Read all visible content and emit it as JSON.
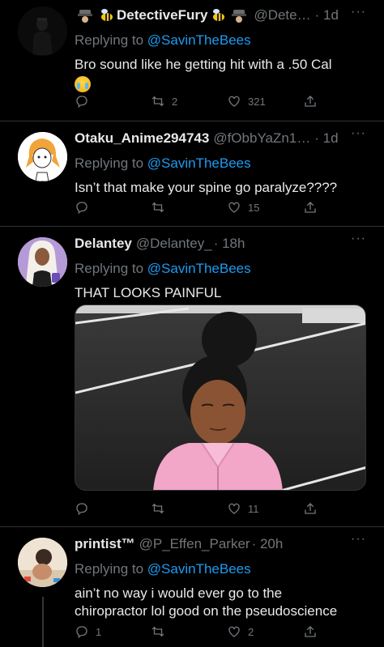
{
  "tweets": [
    {
      "display_name": "DetectiveFury",
      "handle": "@Dete…",
      "time": "· 1d",
      "reply_label": "Replying to",
      "reply_to": "@SavinTheBees",
      "text": "Bro sound like he getting hit with a .50 Cal",
      "emoji": "loudly-crying-face",
      "counts": {
        "reply": "",
        "retweet": "2",
        "like": "321"
      }
    },
    {
      "display_name": "Otaku_Anime294743",
      "handle": "@fObbYaZn1…",
      "time": "· 1d",
      "reply_label": "Replying to",
      "reply_to": "@SavinTheBees",
      "text": "Isn’t that make your spine go paralyze????",
      "counts": {
        "reply": "",
        "retweet": "",
        "like": "15"
      }
    },
    {
      "display_name": "Delantey",
      "handle": "@Delantey_",
      "time": "· 18h",
      "reply_label": "Replying to",
      "reply_to": "@SavinTheBees",
      "text": "THAT LOOKS PAINFUL",
      "media": "reaction-photo",
      "counts": {
        "reply": "",
        "retweet": "",
        "like": "11"
      }
    },
    {
      "display_name": "printist™",
      "handle": "@P_Effen_Parker",
      "time": "· 20h",
      "reply_label": "Replying to",
      "reply_to": "@SavinTheBees",
      "text": "ain’t no way i would ever go to the chiropractor lol good on the pseudoscience",
      "counts": {
        "reply": "1",
        "retweet": "",
        "like": "2"
      }
    }
  ],
  "more_label": "···",
  "colors": {
    "background": "#000000",
    "text": "#e7e9ea",
    "muted": "#71767b",
    "link": "#1d9bf0",
    "divider": "#2f3336"
  }
}
